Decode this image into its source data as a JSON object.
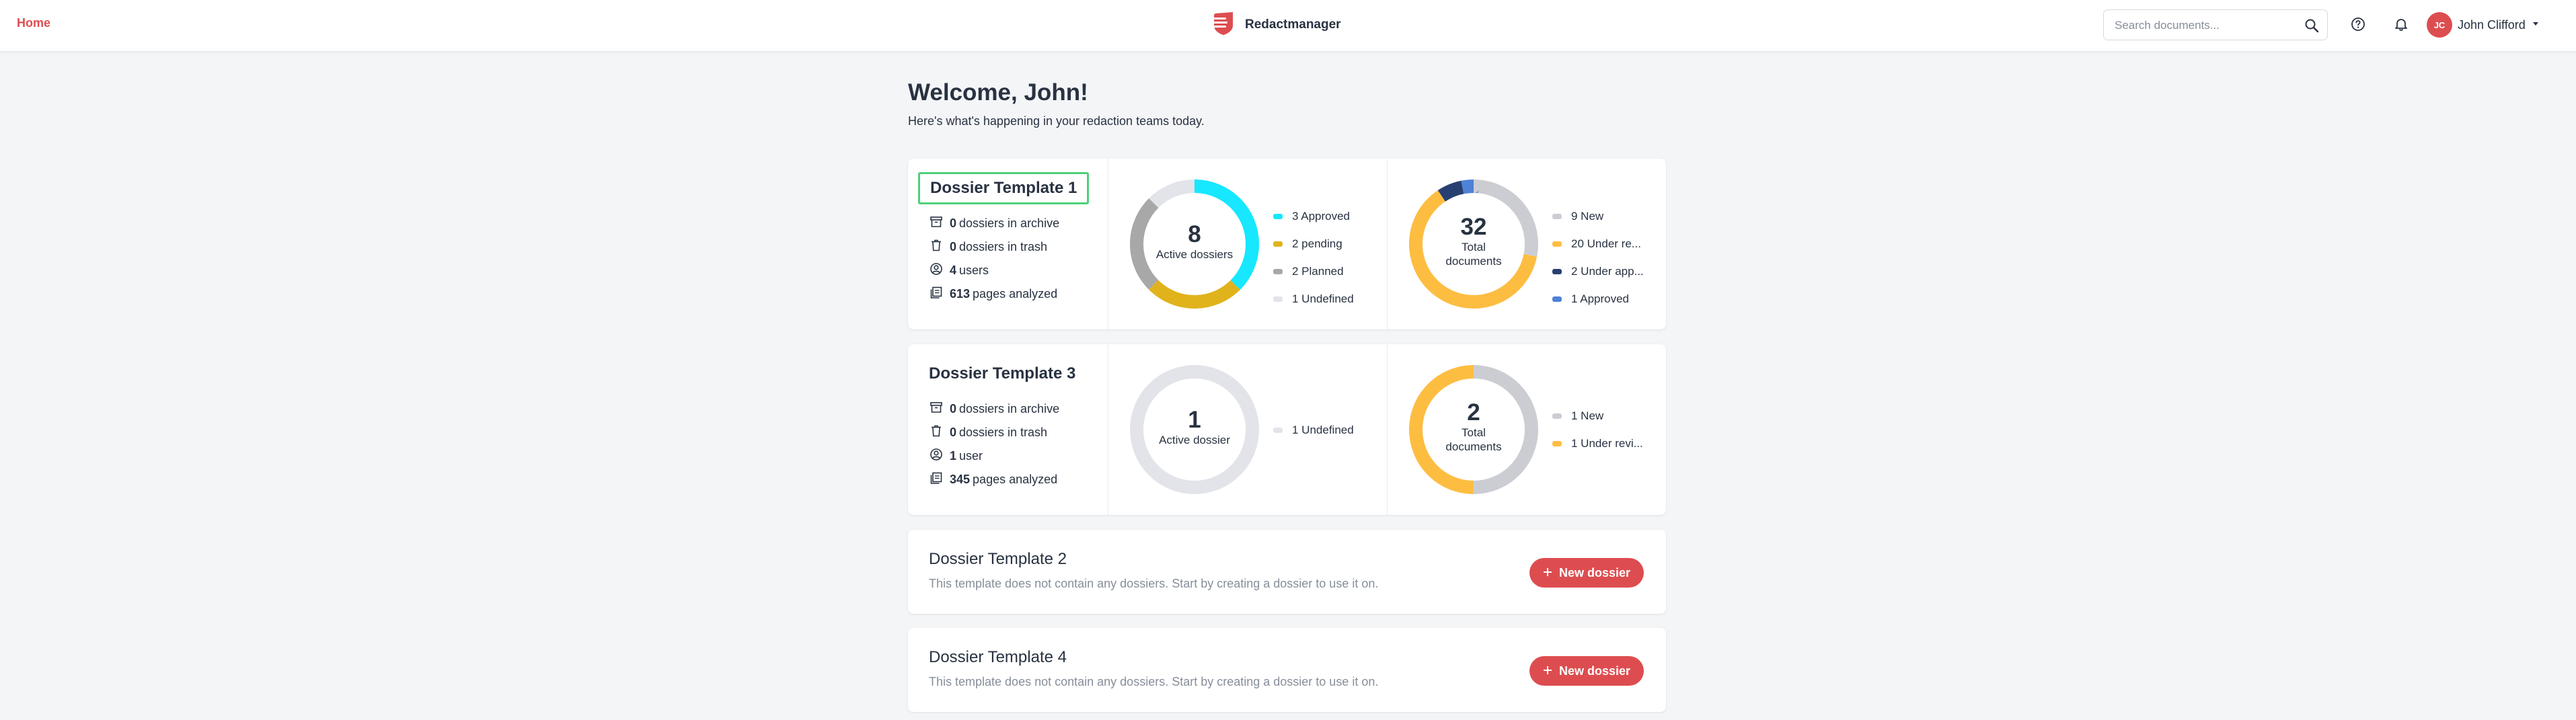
{
  "nav": {
    "home": "Home"
  },
  "brand": {
    "name": "Redactmanager"
  },
  "search": {
    "placeholder": "Search documents..."
  },
  "user": {
    "initials": "JC",
    "name": "John Clifford"
  },
  "welcome": {
    "title": "Welcome, John!",
    "subtitle": "Here's what's happening in your redaction teams today."
  },
  "templates": [
    {
      "title": "Dossier Template 1",
      "stats": [
        {
          "num": "0",
          "text": "dossiers in archive"
        },
        {
          "num": "0",
          "text": "dossiers in trash"
        },
        {
          "num": "4",
          "text": "users"
        },
        {
          "num": "613",
          "text": "pages analyzed"
        }
      ],
      "dossiers": {
        "total": "8",
        "label": "Active dossiers",
        "legend": [
          {
            "label": "3 Approved",
            "value": 3,
            "color": "#17e7ff"
          },
          {
            "label": "2 pending",
            "value": 2,
            "color": "#e0b31c"
          },
          {
            "label": "2 Planned",
            "value": 2,
            "color": "#a8a8a8"
          },
          {
            "label": "1 Undefined",
            "value": 1,
            "color": "#e2e4e9"
          }
        ]
      },
      "documents": {
        "total": "32",
        "label1": "Total",
        "label2": "documents",
        "legend": [
          {
            "label": "9 New",
            "value": 9,
            "color": "#cccdd3"
          },
          {
            "label": "20 Under re...",
            "value": 20,
            "color": "#fdbd41"
          },
          {
            "label": "2 Under app...",
            "value": 2,
            "color": "#283f71"
          },
          {
            "label": "1 Approved",
            "value": 1,
            "color": "#4f81d6"
          }
        ]
      }
    },
    {
      "title": "Dossier Template 3",
      "stats": [
        {
          "num": "0",
          "text": "dossiers in archive"
        },
        {
          "num": "0",
          "text": "dossiers in trash"
        },
        {
          "num": "1",
          "text": "user"
        },
        {
          "num": "345",
          "text": "pages analyzed"
        }
      ],
      "dossiers": {
        "total": "1",
        "label": "Active dossier",
        "legend": [
          {
            "label": "1 Undefined",
            "value": 1,
            "color": "#e2e4e9"
          }
        ]
      },
      "documents": {
        "total": "2",
        "label1": "Total",
        "label2": "documents",
        "legend": [
          {
            "label": "1 New",
            "value": 1,
            "color": "#cccdd3"
          },
          {
            "label": "1 Under revi...",
            "value": 1,
            "color": "#fdbd41"
          }
        ]
      }
    }
  ],
  "empty_templates": [
    {
      "title": "Dossier Template 2",
      "text": "This template does not contain any dossiers. Start by creating a dossier to use it on.",
      "button": "New dossier"
    },
    {
      "title": "Dossier Template 4",
      "text": "This template does not contain any dossiers. Start by creating a dossier to use it on.",
      "button": "New dossier"
    }
  ],
  "icons": [
    "search-icon",
    "help-icon",
    "bell-icon",
    "chevron-down-icon",
    "archive-icon",
    "trash-icon",
    "user-icon",
    "pages-icon",
    "plus-icon",
    "logo-icon"
  ]
}
